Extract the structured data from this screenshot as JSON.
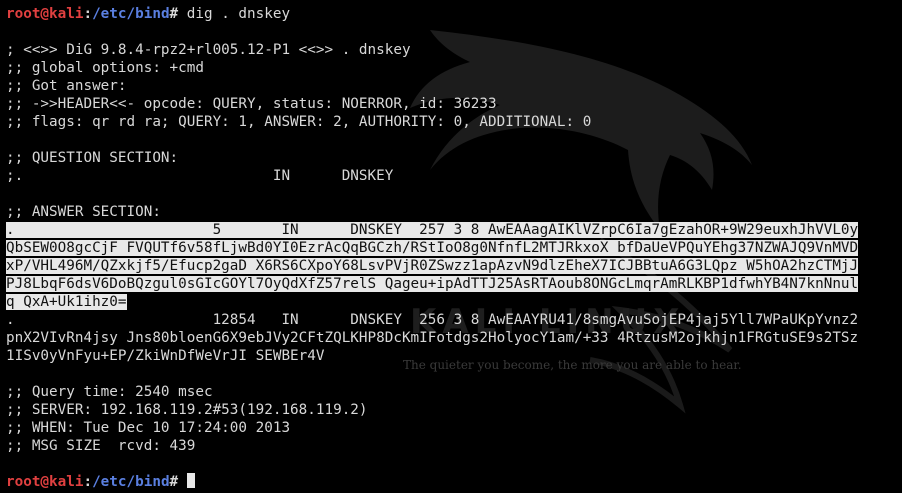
{
  "terminal": {
    "prompt": {
      "user_host": "root@kali",
      "colon": ":",
      "path": "/etc/bind",
      "symbol": "#"
    },
    "command": " dig . dnskey",
    "header_lines": [
      "; <<>> DiG 9.8.4-rpz2+rl005.12-P1 <<>> . dnskey",
      ";; global options: +cmd",
      ";; Got answer:",
      ";; ->>HEADER<<- opcode: QUERY, status: NOERROR, id: 36233",
      ";; flags: qr rd ra; QUERY: 1, ANSWER: 2, AUTHORITY: 0, ADDITIONAL: 0"
    ],
    "question_section": [
      ";; QUESTION SECTION:",
      ";.                             IN      DNSKEY"
    ],
    "answer_header": ";; ANSWER SECTION:",
    "answer_record_1": [
      ".                       5       IN      DNSKEY  257 3 8 AwEAAagAIKlVZrpC6Ia7gEzahOR+9W29euxhJhVVL0y",
      "QbSEW0O8gcCjF FVQUTf6v58fLjwBd0YI0EzrAcQqBGCzh/RStIoO8g0NfnfL2MTJRkxoX bfDaUeVPQuYEhg37NZWAJQ9VnMVD",
      "xP/VHL496M/QZxkjf5/Efucp2gaD X6RS6CXpoY68LsvPVjR0ZSwzz1apAzvN9dlzEheX7ICJBBtuA6G3LQpz W5hOA2hzCTMjJ",
      "PJ8LbqF6dsV6DoBQzgul0sGIcGOYl7OyQdXfZ57relS Qageu+ipAdTTJ25AsRTAoub8ONGcLmqrAmRLKBP1dfwhYB4N7knNnul",
      "q QxA+Uk1ihz0="
    ],
    "answer_record_2": [
      ".                       12854   IN      DNSKEY  256 3 8 AwEAAYRU41/8smgAvuSojEP4jaj5Yll7WPaUKpYvnz2",
      "pnX2VIvRn4jsy Jns80bloenG6X9ebJVy2CFtZQLKHP8DcKmIFotdgs2HolyocY1am/+33 4RtzusM2ojkhjn1FRGtuSE9s2TSz",
      "1ISv0yVnFyu+EP/ZkiWnDfWeVrJI SEWBEr4V"
    ],
    "stats_lines": [
      ";; Query time: 2540 msec",
      ";; SERVER: 192.168.119.2#53(192.168.119.2)",
      ";; WHEN: Tue Dec 10 17:24:00 2013",
      ";; MSG SIZE  rcvd: 439"
    ],
    "final_prompt_text": " "
  },
  "wallpaper": {
    "tagline": "The quieter you become, the more you are able to hear.",
    "logo": "kali-dragon-logo"
  },
  "colors": {
    "background": "#000000",
    "text": "#d8d8d8",
    "user_host": "#e04040",
    "path": "#5a7fe0",
    "selection_bg": "#e8e8e8",
    "selection_text": "#111111"
  }
}
